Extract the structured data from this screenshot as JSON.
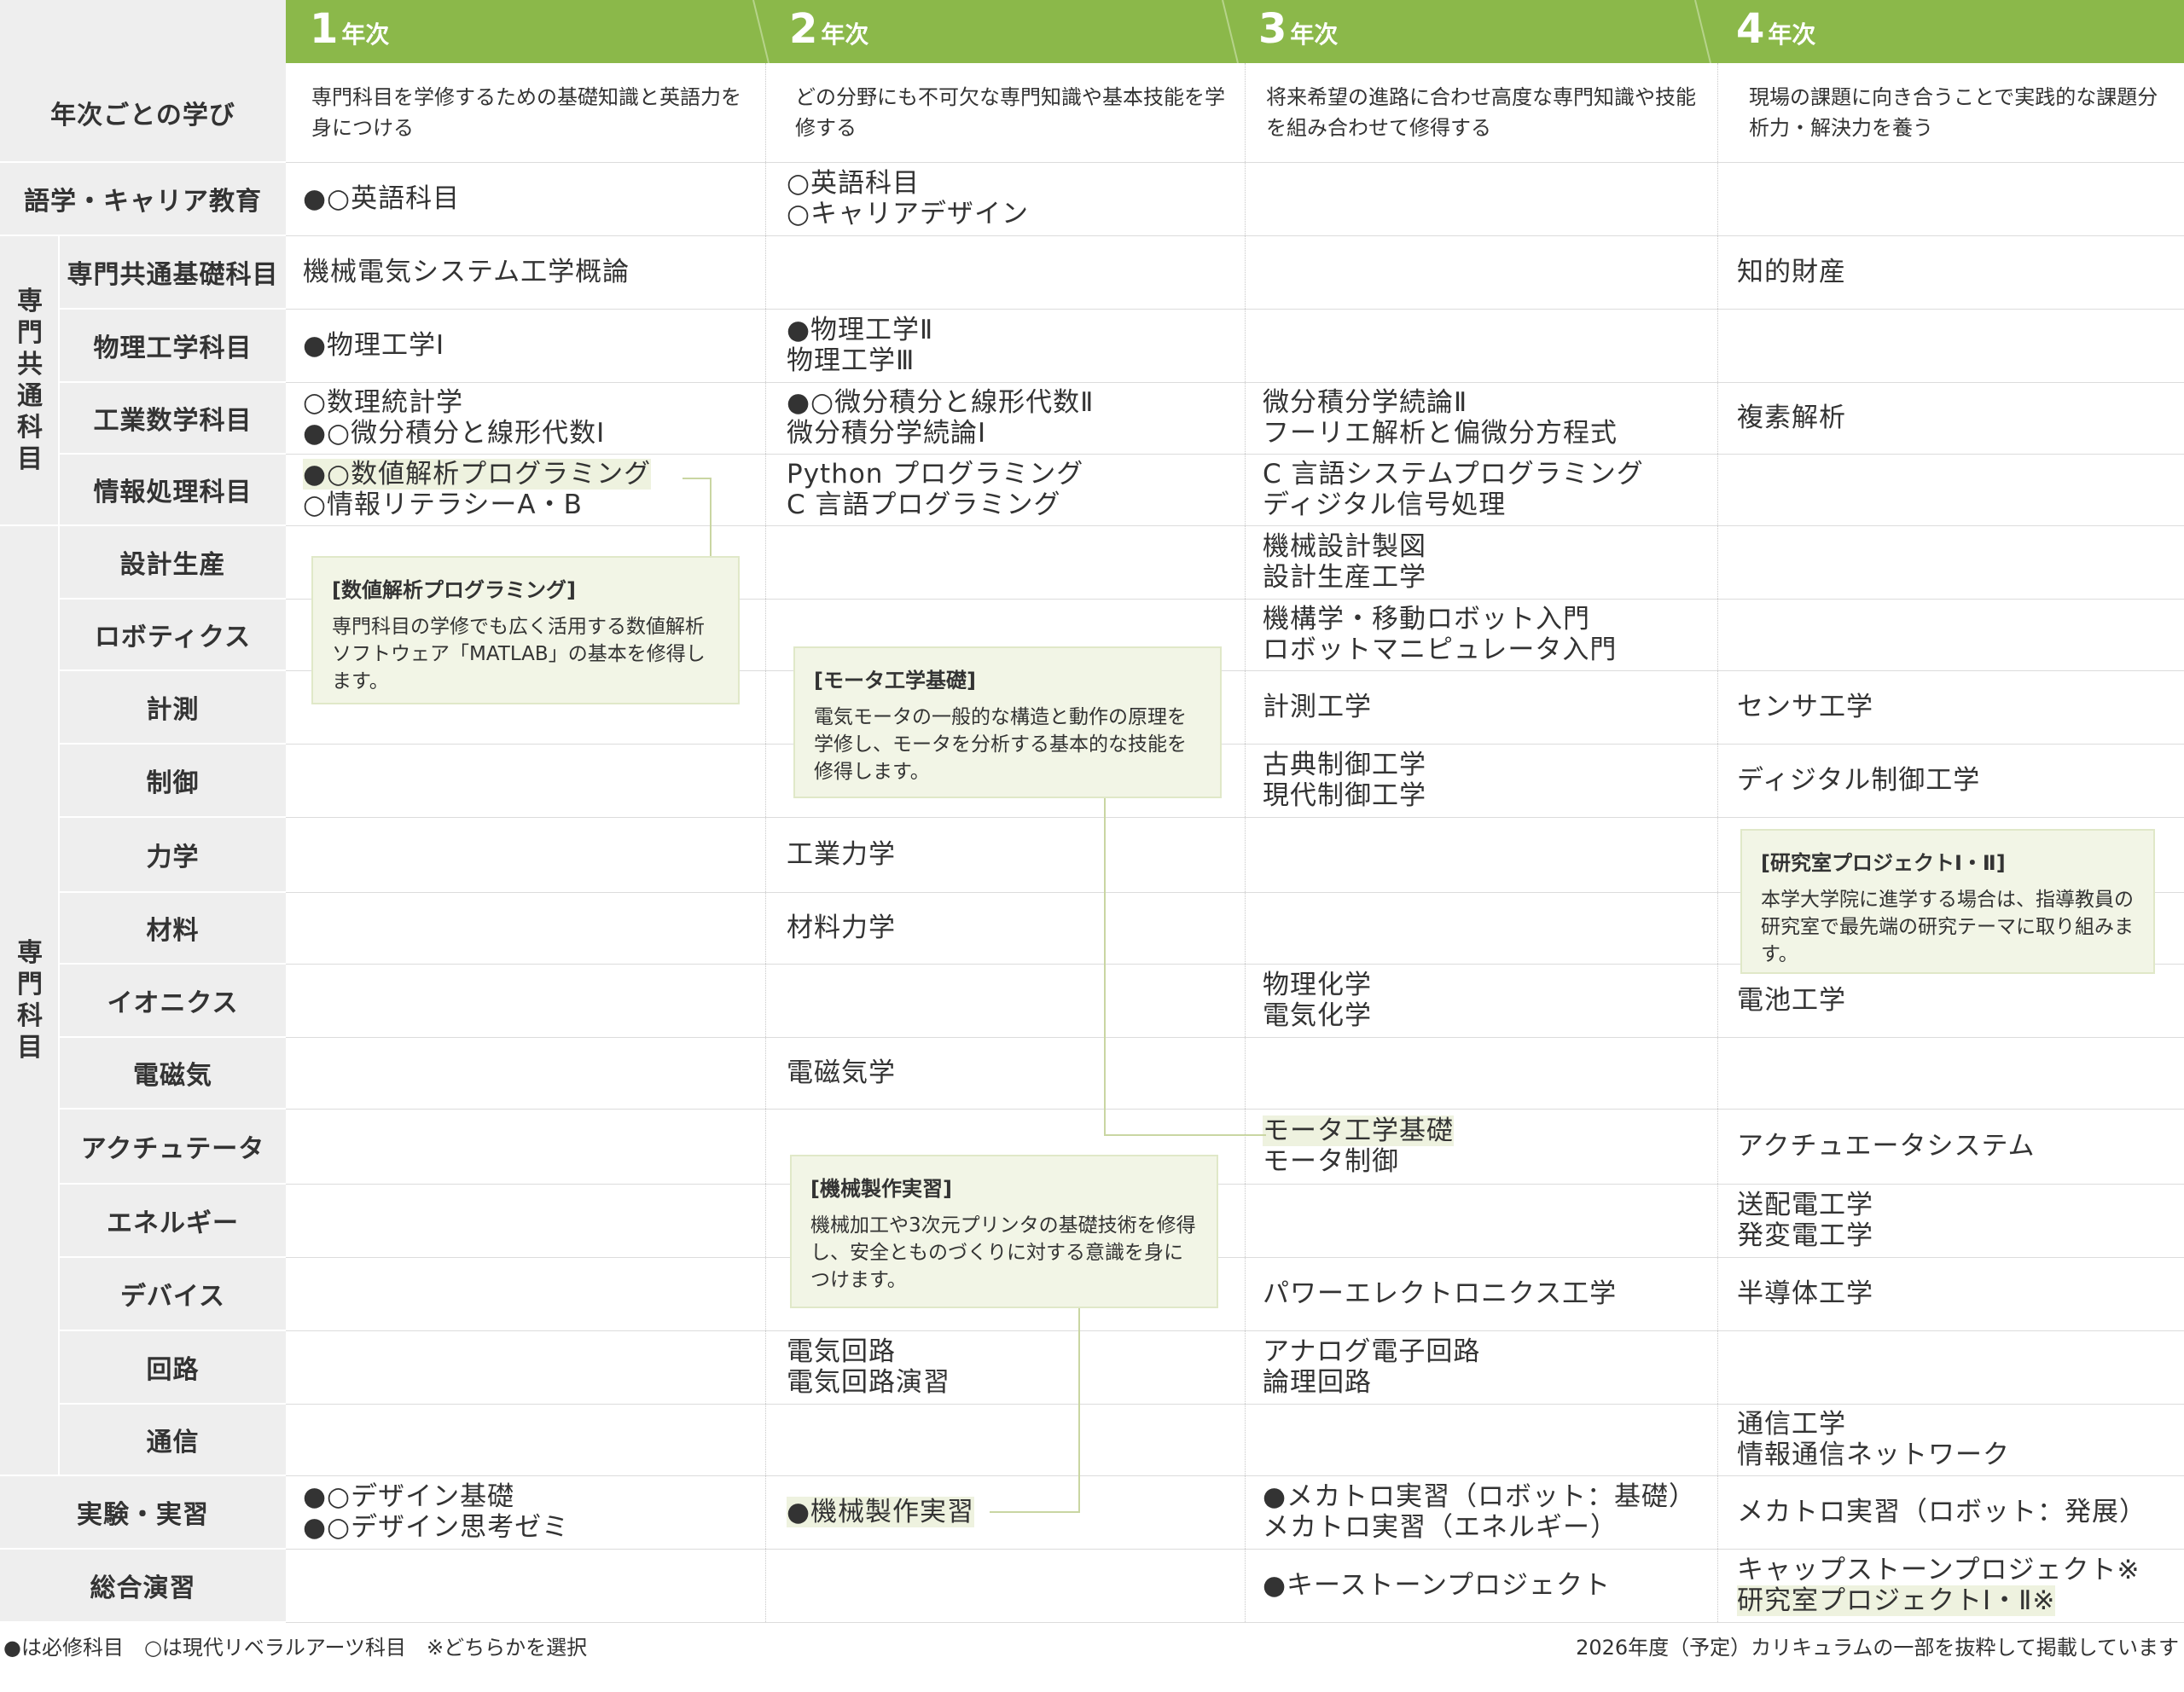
{
  "years": [
    {
      "num": "1",
      "unit": "年次"
    },
    {
      "num": "2",
      "unit": "年次"
    },
    {
      "num": "3",
      "unit": "年次"
    },
    {
      "num": "4",
      "unit": "年次"
    }
  ],
  "learning": {
    "label": "年次ごとの学び",
    "y1": "専門科目を学修するための基礎知識と英語力を身につける",
    "y2": "どの分野にも不可欠な専門知識や基本技能を学修する",
    "y3": "将来希望の進路に合わせ高度な専門知識や技能を組み合わせて修得する",
    "y4": "現場の課題に向き合うことで実践的な課題分析力・解決力を養う"
  },
  "group_labels": {
    "common": "専門共通科目",
    "specialty": "専門科目"
  },
  "rows": {
    "language": {
      "label": "語学・キャリア教育",
      "y1": [
        "●○英語科目"
      ],
      "y2": [
        "○英語科目",
        "○キャリアデザイン"
      ],
      "y3": [],
      "y4": []
    },
    "common_basic": {
      "label": "専門共通基礎科目",
      "y1": [
        "機械電気システム工学概論"
      ],
      "y2": [],
      "y3": [],
      "y4": [
        "知的財産"
      ]
    },
    "physics": {
      "label": "物理工学科目",
      "y1": [
        "●物理工学Ⅰ"
      ],
      "y2": [
        "●物理工学Ⅱ",
        "物理工学Ⅲ"
      ],
      "y3": [],
      "y4": []
    },
    "math": {
      "label": "工業数学科目",
      "y1": [
        "○数理統計学",
        "●○微分積分と線形代数Ⅰ"
      ],
      "y2": [
        "●○微分積分と線形代数Ⅱ",
        "微分積分学続論Ⅰ"
      ],
      "y3": [
        "微分積分学続論Ⅱ",
        "フーリエ解析と偏微分方程式"
      ],
      "y4": [
        "複素解析"
      ]
    },
    "info": {
      "label": "情報処理科目",
      "y1": [
        "●○数値解析プログラミング",
        "○情報リテラシーA・B"
      ],
      "y2": [
        "Python プログラミング",
        "C 言語プログラミング"
      ],
      "y3": [
        "C 言語システムプログラミング",
        "ディジタル信号処理"
      ],
      "y4": []
    },
    "design": {
      "label": "設計生産",
      "y1": [],
      "y2": [],
      "y3": [
        "機械設計製図",
        "設計生産工学"
      ],
      "y4": []
    },
    "robotics": {
      "label": "ロボティクス",
      "y1": [],
      "y2": [],
      "y3": [
        "機構学・移動ロボット入門",
        "ロボットマニピュレータ入門"
      ],
      "y4": []
    },
    "measure": {
      "label": "計測",
      "y1": [],
      "y2": [],
      "y3": [
        "計測工学"
      ],
      "y4": [
        "センサ工学"
      ]
    },
    "control": {
      "label": "制御",
      "y1": [],
      "y2": [],
      "y3": [
        "古典制御工学",
        "現代制御工学"
      ],
      "y4": [
        "ディジタル制御工学"
      ]
    },
    "mechanics": {
      "label": "力学",
      "y1": [],
      "y2": [
        "工業力学"
      ],
      "y3": [],
      "y4": []
    },
    "materials": {
      "label": "材料",
      "y1": [],
      "y2": [
        "材料力学"
      ],
      "y3": [],
      "y4": []
    },
    "ionics": {
      "label": "イオニクス",
      "y1": [],
      "y2": [],
      "y3": [
        "物理化学",
        "電気化学"
      ],
      "y4": [
        "電池工学"
      ]
    },
    "em": {
      "label": "電磁気",
      "y1": [],
      "y2": [
        "電磁気学"
      ],
      "y3": [],
      "y4": []
    },
    "actuator": {
      "label": "アクチュテータ",
      "y1": [],
      "y2": [],
      "y3": [
        "モータ工学基礎",
        "モータ制御"
      ],
      "y4": [
        "アクチュエータシステム"
      ]
    },
    "energy": {
      "label": "エネルギー",
      "y1": [],
      "y2": [],
      "y3": [],
      "y4": [
        "送配電工学",
        "発変電工学"
      ]
    },
    "device": {
      "label": "デバイス",
      "y1": [],
      "y2": [],
      "y3": [
        "パワーエレクトロニクス工学"
      ],
      "y4": [
        "半導体工学"
      ]
    },
    "circuit": {
      "label": "回路",
      "y1": [],
      "y2": [
        "電気回路",
        "電気回路演習"
      ],
      "y3": [
        "アナログ電子回路",
        "論理回路"
      ],
      "y4": []
    },
    "comm": {
      "label": "通信",
      "y1": [],
      "y2": [],
      "y3": [],
      "y4": [
        "通信工学",
        "情報通信ネットワーク"
      ]
    },
    "lab": {
      "label": "実験・実習",
      "y1": [
        "●○デザイン基礎",
        "●○デザイン思考ゼミ"
      ],
      "y2": [
        "●機械製作実習"
      ],
      "y3": [
        "●メカトロ実習（ロボット：基礎）",
        "メカトロ実習（エネルギー）"
      ],
      "y4": [
        "メカトロ実習（ロボット：発展）"
      ]
    },
    "synthesis": {
      "label": "総合演習",
      "y1": [],
      "y2": [],
      "y3": [
        "●キーストーンプロジェクト"
      ],
      "y4": [
        "キャップストーンプロジェクト※",
        "研究室プロジェクトⅠ・Ⅱ※"
      ]
    }
  },
  "notes": {
    "numerical": {
      "title": "[数値解析プログラミング]",
      "body": "専門科目の学修でも広く活用する数値解析ソフトウェア「MATLAB」の基本を修得します。"
    },
    "motor": {
      "title": "[モータ工学基礎]",
      "body": "電気モータの一般的な構造と動作の原理を学修し、モータを分析する基本的な技能を修得します。"
    },
    "lab_project": {
      "title": "[研究室プロジェクトⅠ・Ⅱ]",
      "body": "本学大学院に進学する場合は、指導教員の研究室で最先端の研究テーマに取り組みます。"
    },
    "machining": {
      "title": "[機械製作実習]",
      "body": "機械加工や3次元プリンタの基礎技術を修得し、安全とものづくりに対する意識を身につけます。"
    }
  },
  "footer": {
    "legend": "●は必修科目　○は現代リベラルアーツ科目　※どちらかを選択",
    "note": "2026年度（予定）カリキュラムの一部を抜粋して掲載しています"
  },
  "colors": {
    "header_green": "#8bb84a",
    "label_grey": "#eeeeee",
    "note_bg": "#f2f5e6",
    "connector": "#c9d6a2"
  }
}
